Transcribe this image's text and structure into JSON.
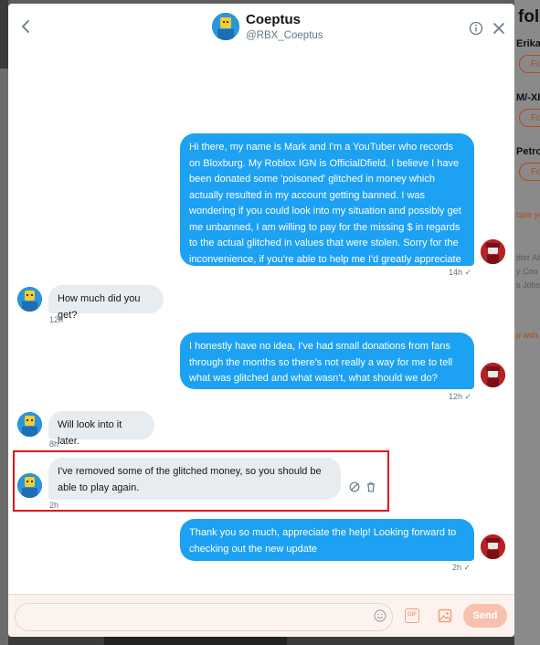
{
  "header": {
    "name": "Coeptus",
    "handle": "@RBX_Coeptus"
  },
  "background": {
    "right_title": "follo",
    "right_names": [
      "Erika",
      "M/-XII",
      "PetroD"
    ],
    "follow_label": "Fol",
    "muted_1": "ople yo",
    "muted_2": "itter Ab",
    "muted_3": "y Coo",
    "muted_4": "s Jobs",
    "muted_5": "e with"
  },
  "messages": [
    {
      "direction": "out",
      "text": "Hi there, my name is Mark and I'm a YouTuber who records on Bloxburg. My Roblox IGN is OfficialDfield. I believe I have been donated some 'poisoned' glitched in money which actually resulted in my account getting banned. I was wondering if you could look into my situation and possibly get me unbanned, I am willing to pay for the missing $ in regards to the actual glitched in values that were stolen. Sorry for the inconvenience, if you're able to help me I'd greatly appreciate it!",
      "time": "14h ✓"
    },
    {
      "direction": "in",
      "text": "How much did you get?",
      "time": "12h"
    },
    {
      "direction": "out",
      "text": "I honestly have no idea, I've had small donations from fans through the months so there's not really a way for me to tell what was glitched and what wasn't, what should we do?",
      "time": "12h ✓"
    },
    {
      "direction": "in",
      "text": "Will look into it later.",
      "time": "8h"
    },
    {
      "direction": "in",
      "text": "I've removed some of the glitched money, so you should be able to play again.",
      "time": "2h"
    },
    {
      "direction": "out",
      "text": "Thank you so much, appreciate the help! Looking forward to checking out the new update",
      "time": "2h ✓"
    }
  ],
  "composer": {
    "placeholder": "",
    "gif_label": "GIF",
    "send_label": "Send"
  },
  "colors": {
    "accent": "#1da1f2",
    "highlight": "#e0121c",
    "send_disabled": "#f6c2ad"
  }
}
